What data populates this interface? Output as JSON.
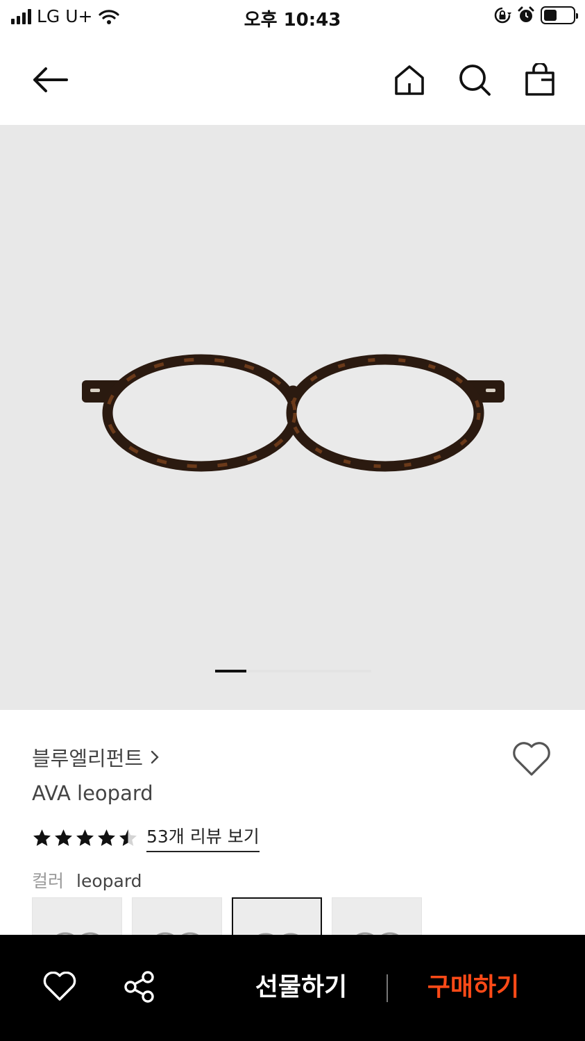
{
  "status_bar": {
    "carrier": "LG U+",
    "time": "오후 10:43",
    "battery_level": 0.45,
    "icons": [
      "signal-icon",
      "wifi-icon",
      "rotation-lock-icon",
      "alarm-icon",
      "battery-icon"
    ]
  },
  "nav": {
    "icons": [
      "back-arrow-icon",
      "home-icon",
      "search-icon",
      "shopping-bag-icon"
    ]
  },
  "gallery": {
    "current_page": 1,
    "total_pages": 5
  },
  "product": {
    "brand": "블루엘리펀트",
    "name": "AVA leopard",
    "rating": 4.5,
    "review_link": "53개 리뷰 보기",
    "color_label": "컬러",
    "color_value": "leopard",
    "swatch_count": 4,
    "selected_swatch": 3
  },
  "bottom_bar": {
    "gift_label": "선물하기",
    "buy_label": "구매하기",
    "buy_color": "#ff4a17",
    "icons": [
      "heart-icon",
      "share-icon"
    ]
  }
}
